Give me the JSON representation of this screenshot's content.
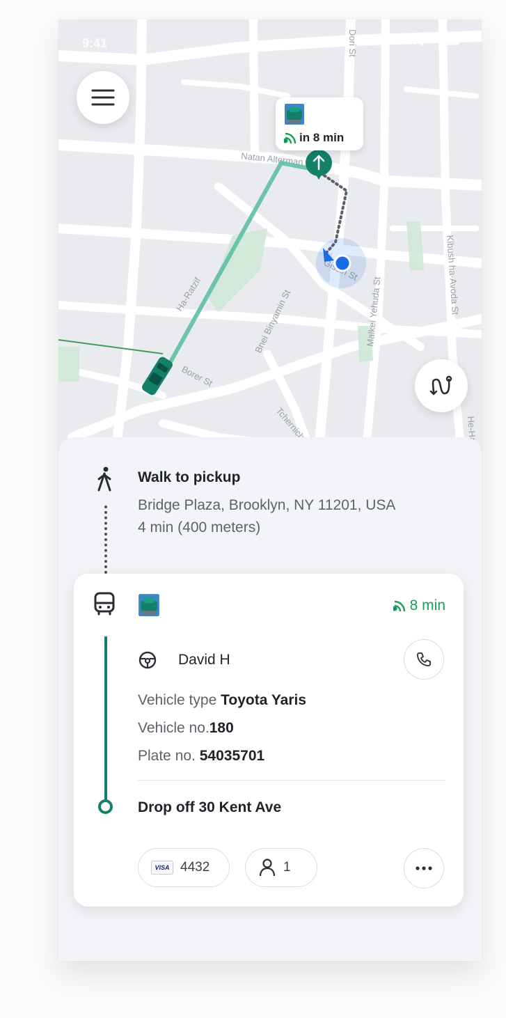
{
  "status_bar": {
    "time": "9:41"
  },
  "map": {
    "streets": [
      "Dori St",
      "Natan Alterman St",
      "Bnei Binyamin St",
      "Gissin St",
      "Malkei Yehuda St",
      "Kibush ha-Avoda St",
      "Borer St",
      "Tchernichovsky",
      "He-Halutz",
      "Ha-Ratzif"
    ],
    "eta_bubble": {
      "text": "in 8 min"
    }
  },
  "walk": {
    "title": "Walk to pickup",
    "address": "Bridge Plaza, Brooklyn, NY 11201, USA",
    "duration": "4 min (400 meters)"
  },
  "ride": {
    "eta": "8 min",
    "driver": "David H",
    "vehicle_type_label": "Vehicle type",
    "vehicle_type": "Toyota Yaris",
    "vehicle_no_label": "Vehicle no.",
    "vehicle_no": "180",
    "plate_no_label": "Plate no.",
    "plate_no": "54035701",
    "dropoff": "Drop off 30 Kent Ave",
    "payment": {
      "brand": "VISA",
      "last4": "4432"
    },
    "passengers": "1"
  },
  "colors": {
    "accent": "#14806a",
    "eta": "#16a05d",
    "user_dot": "#1a6be6"
  }
}
